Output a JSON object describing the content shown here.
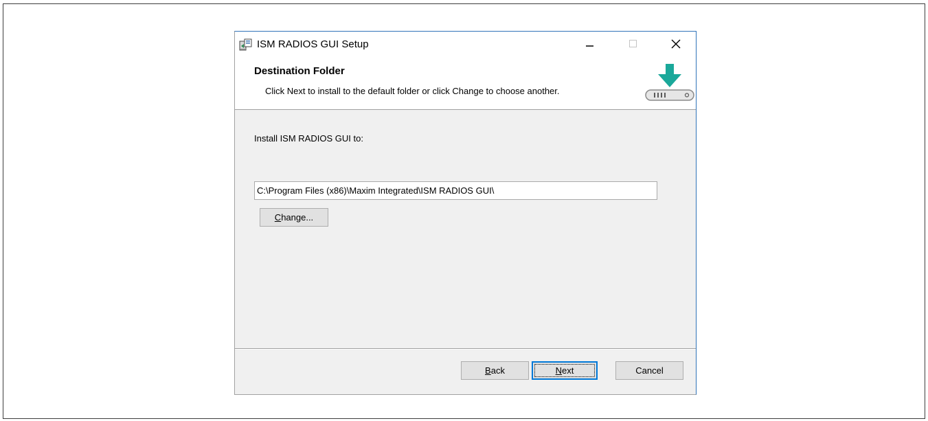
{
  "window": {
    "title": "ISM RADIOS GUI Setup",
    "minimize_label": "—",
    "maximize_label": "□",
    "close_label": "×"
  },
  "header": {
    "title": "Destination Folder",
    "description": "Click Next to install to the default folder or click Change to choose another.",
    "icon": "download-drive-icon"
  },
  "main": {
    "install_label": "Install ISM RADIOS GUI to:",
    "install_path": "C:\\Program Files (x86)\\Maxim Integrated\\ISM RADIOS GUI\\",
    "change_button": {
      "mnemonic": "C",
      "rest": "hange..."
    }
  },
  "footer": {
    "back_button": {
      "mnemonic": "B",
      "rest": "ack"
    },
    "next_button": {
      "mnemonic": "N",
      "rest": "ext"
    },
    "cancel_button": {
      "label": "Cancel"
    }
  },
  "colors": {
    "accent": "#0078d7",
    "window_border": "#2f73b9",
    "dialog_background": "#f0f0f0",
    "arrow_teal": "#1aa89a"
  }
}
